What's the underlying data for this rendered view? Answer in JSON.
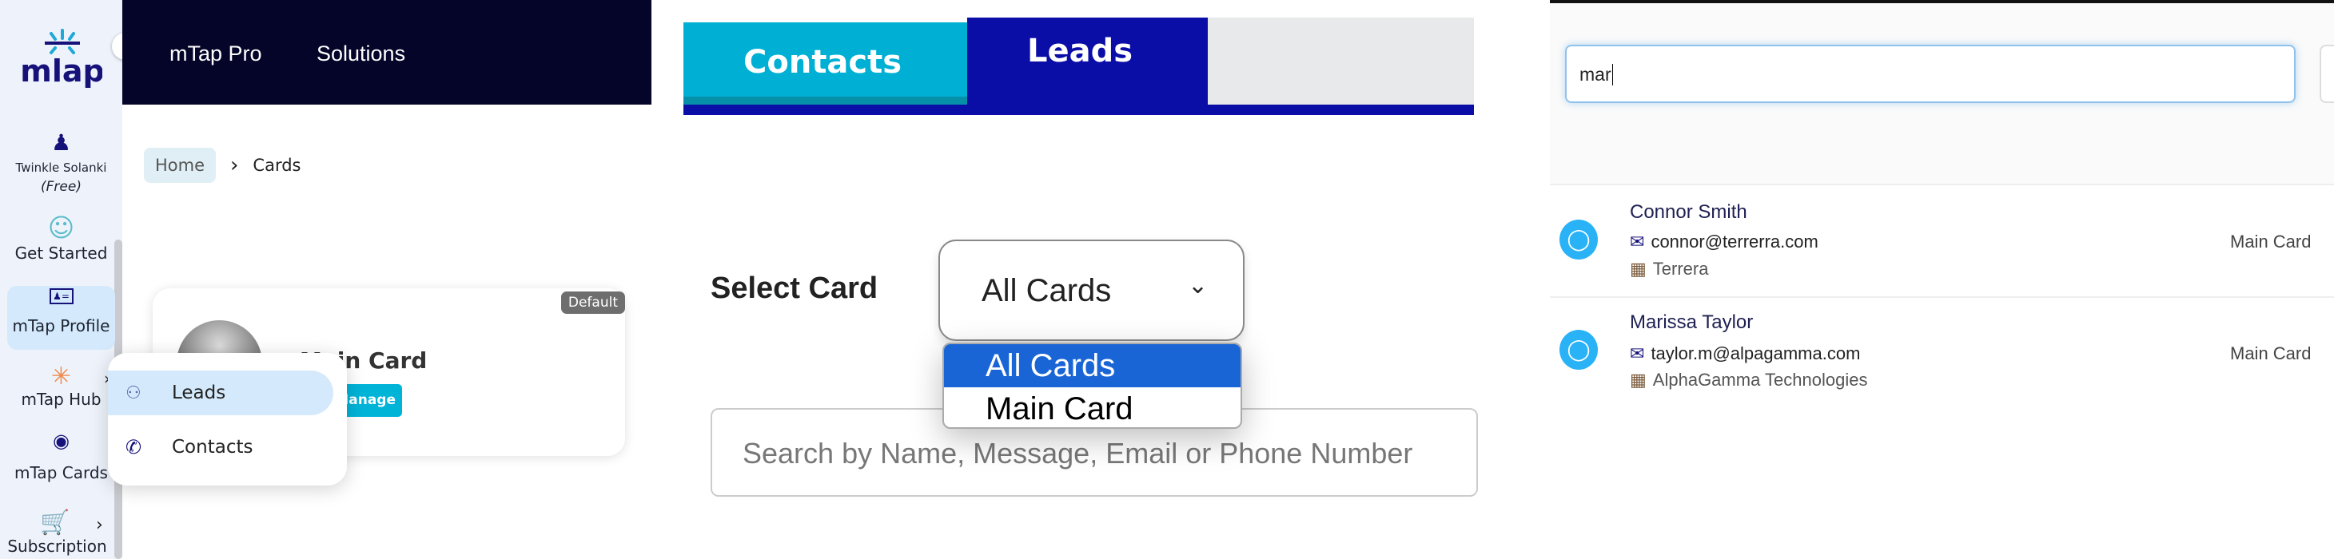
{
  "sidebar": {
    "logo": "mTap",
    "user": {
      "name": "Twinkle Solanki",
      "plan": "(Free)"
    },
    "items": [
      {
        "label": "Get Started",
        "icon": "user-circle-icon"
      },
      {
        "label": "mTap Profile",
        "icon": "id-card-icon",
        "active": true
      },
      {
        "label": "mTap Hub",
        "icon": "hub-icon"
      },
      {
        "label": "mTap Cards",
        "icon": "nfc-card-icon"
      },
      {
        "label": "Subscription",
        "icon": "cart-icon"
      }
    ]
  },
  "header": {
    "nav": [
      "mTap Pro",
      "Solutions"
    ]
  },
  "breadcrumb": {
    "home": "Home",
    "current": "Cards"
  },
  "card": {
    "name": "Main Card",
    "badge": "Default",
    "manage": "Manage"
  },
  "hub_menu": {
    "items": [
      {
        "label": "Leads",
        "icon": "users-icon",
        "highlighted": true
      },
      {
        "label": "Contacts",
        "icon": "phone-contact-icon"
      }
    ]
  },
  "tabs": {
    "items": [
      "Contacts",
      "Leads"
    ],
    "active": "Leads"
  },
  "select_card": {
    "label": "Select Card",
    "value": "All Cards",
    "options": [
      "All Cards",
      "Main Card"
    ],
    "highlighted": "All Cards"
  },
  "search": {
    "placeholder": "Search by Name, Message, Email or Phone Number"
  },
  "leads_search": {
    "value": "mar"
  },
  "results": [
    {
      "name": "Connor Smith",
      "email": "connor@terrerra.com",
      "company": "Terrera",
      "card": "Main Card"
    },
    {
      "name": "Marissa Taylor",
      "email": "taylor.m@alpagamma.com",
      "company": "AlphaGamma Technologies",
      "card": "Main Card"
    }
  ],
  "colors": {
    "header": "#05052a",
    "contacts_tab": "#00b0d4",
    "leads_tab": "#0a0ea6",
    "option_highlight": "#1a65d6",
    "avatar": "#2ab2f7",
    "manage": "#00b4d8"
  }
}
